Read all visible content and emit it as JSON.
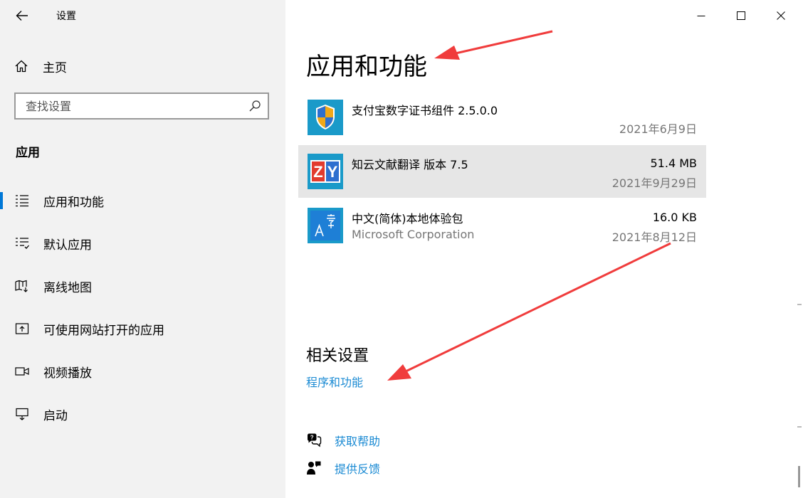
{
  "window": {
    "title": "设置",
    "controls": {
      "minimize": "minimize-icon",
      "maximize": "maximize-icon",
      "close": "close-icon"
    }
  },
  "sidebar": {
    "home_label": "主页",
    "search_placeholder": "查找设置",
    "section_label": "应用",
    "items": [
      {
        "label": "应用和功能",
        "icon": "apps-list-icon",
        "selected": true
      },
      {
        "label": "默认应用",
        "icon": "default-apps-icon",
        "selected": false
      },
      {
        "label": "离线地图",
        "icon": "offline-map-icon",
        "selected": false
      },
      {
        "label": "可使用网站打开的应用",
        "icon": "open-website-icon",
        "selected": false
      },
      {
        "label": "视频播放",
        "icon": "video-icon",
        "selected": false
      },
      {
        "label": "启动",
        "icon": "startup-icon",
        "selected": false
      }
    ]
  },
  "main": {
    "title": "应用和功能",
    "apps": [
      {
        "name": "支付宝数字证书组件 2.5.0.0",
        "publisher": "",
        "size": "",
        "date": "2021年6月9日",
        "icon": "shield-icon"
      },
      {
        "name": "知云文献翻译 版本 7.5",
        "publisher": "",
        "size": "51.4 MB",
        "date": "2021年9月29日",
        "icon": "zy-app-icon"
      },
      {
        "name": "中文(简体)本地体验包",
        "publisher": "Microsoft Corporation",
        "size": "16.0 KB",
        "date": "2021年8月12日",
        "icon": "language-pack-icon"
      }
    ],
    "related": {
      "title": "相关设置",
      "link": "程序和功能"
    },
    "help": {
      "get_help": "获取帮助",
      "feedback": "提供反馈"
    }
  },
  "colors": {
    "accent": "#0078d7",
    "link": "#1a8ad3",
    "annotation_arrow": "#f03c3c"
  }
}
